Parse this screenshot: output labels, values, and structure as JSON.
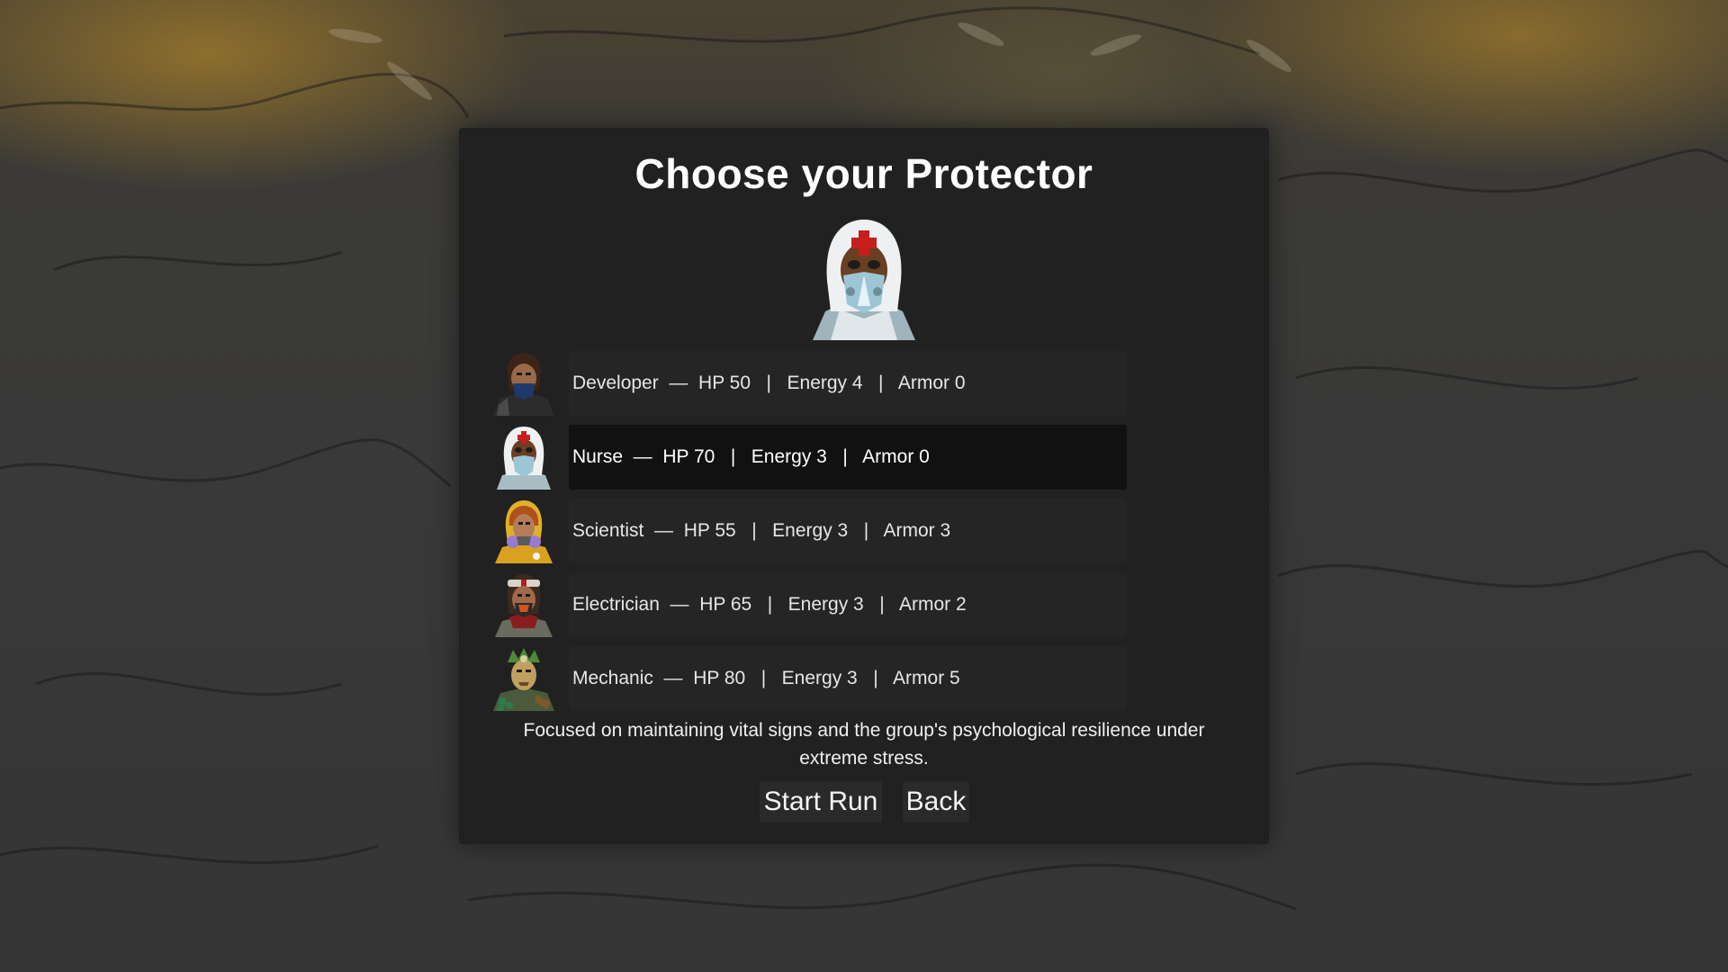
{
  "screen": {
    "title": "Choose your Protector",
    "selected_hero_icon": "nurse-portrait-icon",
    "description": "Focused on maintaining vital signs and the group's psychological resilience under extreme stress."
  },
  "characters": [
    {
      "name": "Developer",
      "hp": 50,
      "energy": 4,
      "armor": 0,
      "icon": "developer-portrait-icon",
      "selected": false,
      "line": "Developer  —  HP 50   |   Energy 4   |   Armor 0"
    },
    {
      "name": "Nurse",
      "hp": 70,
      "energy": 3,
      "armor": 0,
      "icon": "nurse-portrait-icon",
      "selected": true,
      "line": "Nurse  —  HP 70   |   Energy 3   |   Armor 0"
    },
    {
      "name": "Scientist",
      "hp": 55,
      "energy": 3,
      "armor": 3,
      "icon": "scientist-portrait-icon",
      "selected": false,
      "line": "Scientist  —  HP 55   |   Energy 3   |   Armor 3"
    },
    {
      "name": "Electrician",
      "hp": 65,
      "energy": 3,
      "armor": 2,
      "icon": "electrician-portrait-icon",
      "selected": false,
      "line": "Electrician  —  HP 65   |   Energy 3   |   Armor 2"
    },
    {
      "name": "Mechanic",
      "hp": 80,
      "energy": 3,
      "armor": 5,
      "icon": "mechanic-portrait-icon",
      "selected": false,
      "line": "Mechanic  —  HP 80   |   Energy 3   |   Armor 5"
    }
  ],
  "buttons": {
    "start_label": "Start Run",
    "back_label": "Back"
  },
  "colors": {
    "panel_bg": "#202020",
    "row_bg": "#252525",
    "row_selected_bg": "#111111",
    "nurse_cross": "#c81e1e"
  }
}
